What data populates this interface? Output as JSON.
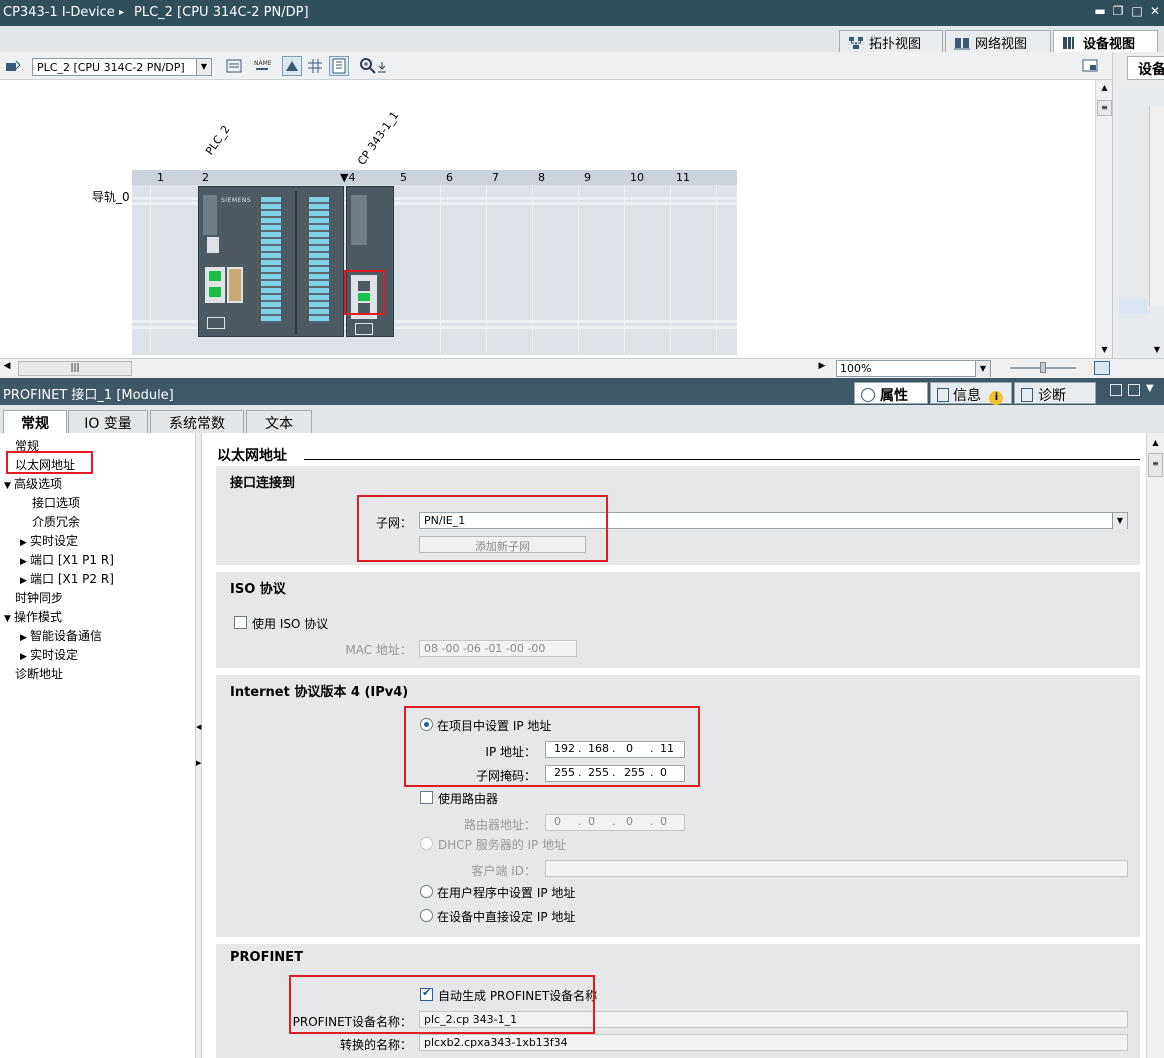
{
  "titlebar": {
    "project": "CP343-1 I-Device",
    "separator": "▸",
    "device": "PLC_2 [CPU 314C-2 PN/DP]",
    "win_min": "▬",
    "win_restore": "❐",
    "win_close": "✕"
  },
  "view_tabs": [
    {
      "label": "拓扑视图"
    },
    {
      "label": "网络视图"
    },
    {
      "label": "设备视图"
    }
  ],
  "device_toolbar": {
    "device_select": "PLC_2 [CPU 314C-2 PN/DP]",
    "zoom": "100%"
  },
  "right_strip": {
    "label": "设备"
  },
  "rack": {
    "rail_label": "导轨_0",
    "plc_label": "PLC_2",
    "cp_label": "CP 343-1_1",
    "slots": [
      "1",
      "2",
      "▼4",
      "5",
      "6",
      "7",
      "8",
      "9",
      "10",
      "11"
    ],
    "brand": "SIEMENS"
  },
  "inspector": {
    "title": "PROFINET 接口_1 [Module]",
    "tabs": [
      {
        "label": "属性"
      },
      {
        "label": "信息"
      },
      {
        "label": "诊断"
      }
    ],
    "info_badge": "i"
  },
  "property_tabs": [
    {
      "label": "常规"
    },
    {
      "label": "IO 变量"
    },
    {
      "label": "系统常数"
    },
    {
      "label": "文本"
    }
  ],
  "nav": [
    {
      "label": "常规",
      "tri": ""
    },
    {
      "label": "以太网地址",
      "tri": ""
    },
    {
      "label": "高级选项",
      "tri": "▼"
    },
    {
      "label": "接口选项",
      "tri": ""
    },
    {
      "label": "介质冗余",
      "tri": ""
    },
    {
      "label": "实时设定",
      "tri": "▶"
    },
    {
      "label": "端口 [X1 P1 R]",
      "tri": "▶"
    },
    {
      "label": "端口 [X1 P2 R]",
      "tri": "▶"
    },
    {
      "label": "时钟同步",
      "tri": ""
    },
    {
      "label": "操作模式",
      "tri": "▼"
    },
    {
      "label": "智能设备通信",
      "tri": "▶"
    },
    {
      "label": "实时设定",
      "tri": "▶"
    },
    {
      "label": "诊断地址",
      "tri": ""
    }
  ],
  "content": {
    "title": "以太网地址",
    "interface": {
      "heading": "接口连接到",
      "subnet_label": "子网：",
      "subnet_value": "PN/IE_1",
      "add_subnet": "添加新子网"
    },
    "iso": {
      "heading": "ISO 协议",
      "use_iso": "使用 ISO 协议",
      "mac_label": "MAC 地址：",
      "mac_value": "08 -00 -06 -01 -00 -00"
    },
    "ipv4": {
      "heading": "Internet 协议版本 4 (IPv4)",
      "set_in_project": "在项目中设置 IP 地址",
      "ip_label": "IP 地址：",
      "ip": [
        "192",
        "168",
        "0",
        "11"
      ],
      "mask_label": "子网掩码：",
      "mask": [
        "255",
        "255",
        "255",
        "0"
      ],
      "use_router": "使用路由器",
      "router_label": "路由器地址：",
      "router": [
        "0",
        "0",
        "0",
        "0"
      ],
      "dhcp": "DHCP 服务器的 IP 地址",
      "client_id_label": "客户端 ID：",
      "user_program": "在用户程序中设置 IP 地址",
      "direct_on_device": "在设备中直接设定 IP 地址"
    },
    "profinet": {
      "heading": "PROFINET",
      "auto_name": "自动生成 PROFINET设备名称",
      "name_label": "PROFINET设备名称：",
      "name_value": "plc_2.cp 343-1_1",
      "converted_label": "转换的名称：",
      "converted_value": "plcxb2.cpxa343-1xb13f34"
    }
  },
  "colors": {
    "highlight": "#e11c24",
    "titlebar": "#2f4f5b",
    "port_green": "#18c04a"
  }
}
